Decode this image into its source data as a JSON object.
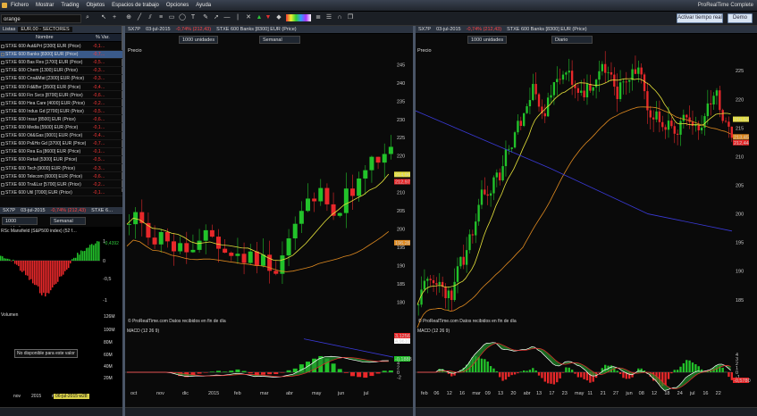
{
  "menu": [
    "Fichero",
    "Mostrar",
    "Trading",
    "Objetos",
    "Espacios de trabajo",
    "Opciones",
    "Ayuda"
  ],
  "app_title": "ProRealTime Complete",
  "search_value": "orange",
  "buttons": {
    "live": "Activar tiempo real",
    "demo": "Demo"
  },
  "lists": {
    "title": "Listas",
    "list_name": "EUR.00 - SECTORES",
    "col_name": "Nombre",
    "col_var": "% Var.",
    "rows": [
      {
        "name": "STXE 600 Aut&Prt [2300] EUR (Price)",
        "ch": "-0,1…"
      },
      {
        "name": "STXE 600 Banks [8300] EUR (Price)",
        "ch": "-0,7…"
      },
      {
        "name": "STXE 600 Bas Res [1700] EUR (Price)",
        "ch": "-0,5…"
      },
      {
        "name": "STXE 600 Chem [1300] EUR (Price)",
        "ch": "-0,3…"
      },
      {
        "name": "STXE 600 Cns&Mat [2300] EUR (Price)",
        "ch": "-0,3…"
      },
      {
        "name": "STXE 600 Fd&Bvr [3500] EUR (Price)",
        "ch": "-0,4…"
      },
      {
        "name": "STXE 600 Fin Svcs [8700] EUR (Price)",
        "ch": "-0,6…"
      },
      {
        "name": "STXE 600 Hea Care [4000] EUR (Price)",
        "ch": "-0,2…"
      },
      {
        "name": "STXE 600 Indus Gd [2700] EUR (Price)",
        "ch": "-0,5…"
      },
      {
        "name": "STXE 600 Insur [8500] EUR (Price)",
        "ch": "-0,6…"
      },
      {
        "name": "STXE 600 Media [5500] EUR (Price)",
        "ch": "-0,1…"
      },
      {
        "name": "STXE 600 Oil&Gas [0001] EUR (Price)",
        "ch": "-0,4…"
      },
      {
        "name": "STXE 600 Pr&Ho Gd [3700] EUR (Price)",
        "ch": "-0,7…"
      },
      {
        "name": "STXE 600 Rea Ea [8600] EUR (Price)",
        "ch": "-0,1…"
      },
      {
        "name": "STXE 600 Retail [5300] EUR (Price)",
        "ch": "-0,5…"
      },
      {
        "name": "STXE 600 Tech [9000] EUR (Price)",
        "ch": "-0,3…"
      },
      {
        "name": "STXE 600 Telecom [6000] EUR (Price)",
        "ch": "-0,6…"
      },
      {
        "name": "STXE 600 Trv&Lsr [5700] EUR (Price)",
        "ch": "-0,2…"
      },
      {
        "name": "STXE 600 Util [7000] EUR (Price)",
        "ch": "-0,1…"
      }
    ]
  },
  "small_chart": {
    "ticker": "SX7P",
    "date": "03-jul-2015",
    "change": "-0,74% (212,43)",
    "name": "STXE 6…",
    "units": "1000 unidades",
    "period": "Semanal",
    "indicator": "RSc Mansfield (S&P500 index) (52 f…",
    "rsc_value": "-0,4392",
    "rsc_ticks": [
      "1",
      "0",
      "-0,5",
      "-1"
    ],
    "volume_label": "Volumen",
    "no_data": "No disponible para este valor",
    "vol_ticks": [
      "126M",
      "100M",
      "80M",
      "60M",
      "40M",
      "20M"
    ],
    "x_ticks": [
      "nov",
      "2015",
      "mar",
      "may"
    ],
    "date_readout": "06-jul-2015 w28"
  },
  "chart_weekly": {
    "ticker": "SX7P",
    "date": "03-jul-2015",
    "change": "-0,74% (212,43)",
    "name": "STXE 600 Banks [8300] EUR (Price)",
    "units": "1000 unidades",
    "period": "Semanal",
    "price_label": "Precio",
    "y_ticks": [
      "245",
      "240",
      "235",
      "230",
      "225",
      "220",
      "215",
      "210",
      "205",
      "200",
      "195",
      "190",
      "185",
      "180"
    ],
    "price_tags": [
      "214,96",
      "212,97",
      "196,28"
    ],
    "footer": "© ProRealTime.com  Datos recibidos en fin de día",
    "macd_label": "MACD (12 26 9)",
    "macd_ticks": [
      "4",
      "2",
      "0",
      "-2"
    ],
    "macd_tags": [
      "3,1256",
      "4,9610",
      "-0,1888"
    ],
    "x_ticks": [
      "oct",
      "nov",
      "dic",
      "2015",
      "feb",
      "mar",
      "abr",
      "may",
      "jun",
      "jul"
    ]
  },
  "chart_daily": {
    "ticker": "SX7P",
    "date": "03-jul-2015",
    "change": "-0,74% (212,43)",
    "name": "STXE 600 Banks [8300] EUR (Price)",
    "units": "1000 unidades",
    "period": "Diario",
    "price_label": "Precio",
    "y_ticks": [
      "225",
      "220",
      "215",
      "210",
      "205",
      "200",
      "195",
      "190",
      "185"
    ],
    "price_tags": [
      "216,53",
      "213,45",
      "212,44"
    ],
    "footer": "© ProRealTime.com  Datos recibidos en fin de día",
    "macd_label": "MACD (12 26 9)",
    "macd_ticks": [
      "4",
      "3",
      "2",
      "1",
      "0",
      "-1",
      "-2"
    ],
    "macd_tags": [
      "-0,5780"
    ],
    "x_ticks": [
      "feb",
      "06",
      "12",
      "16",
      "mar",
      "09",
      "13",
      "20",
      "abr",
      "13",
      "17",
      "23",
      "may",
      "11",
      "21",
      "27",
      "jun",
      "08",
      "12",
      "18",
      "24",
      "jul",
      "16",
      "22"
    ]
  },
  "colors": {
    "up": "#22c22a",
    "down": "#e8282a",
    "ma_short": "#e6e23a",
    "ma_long": "#e08a20",
    "ma_very_long": "#3a3ad8"
  }
}
